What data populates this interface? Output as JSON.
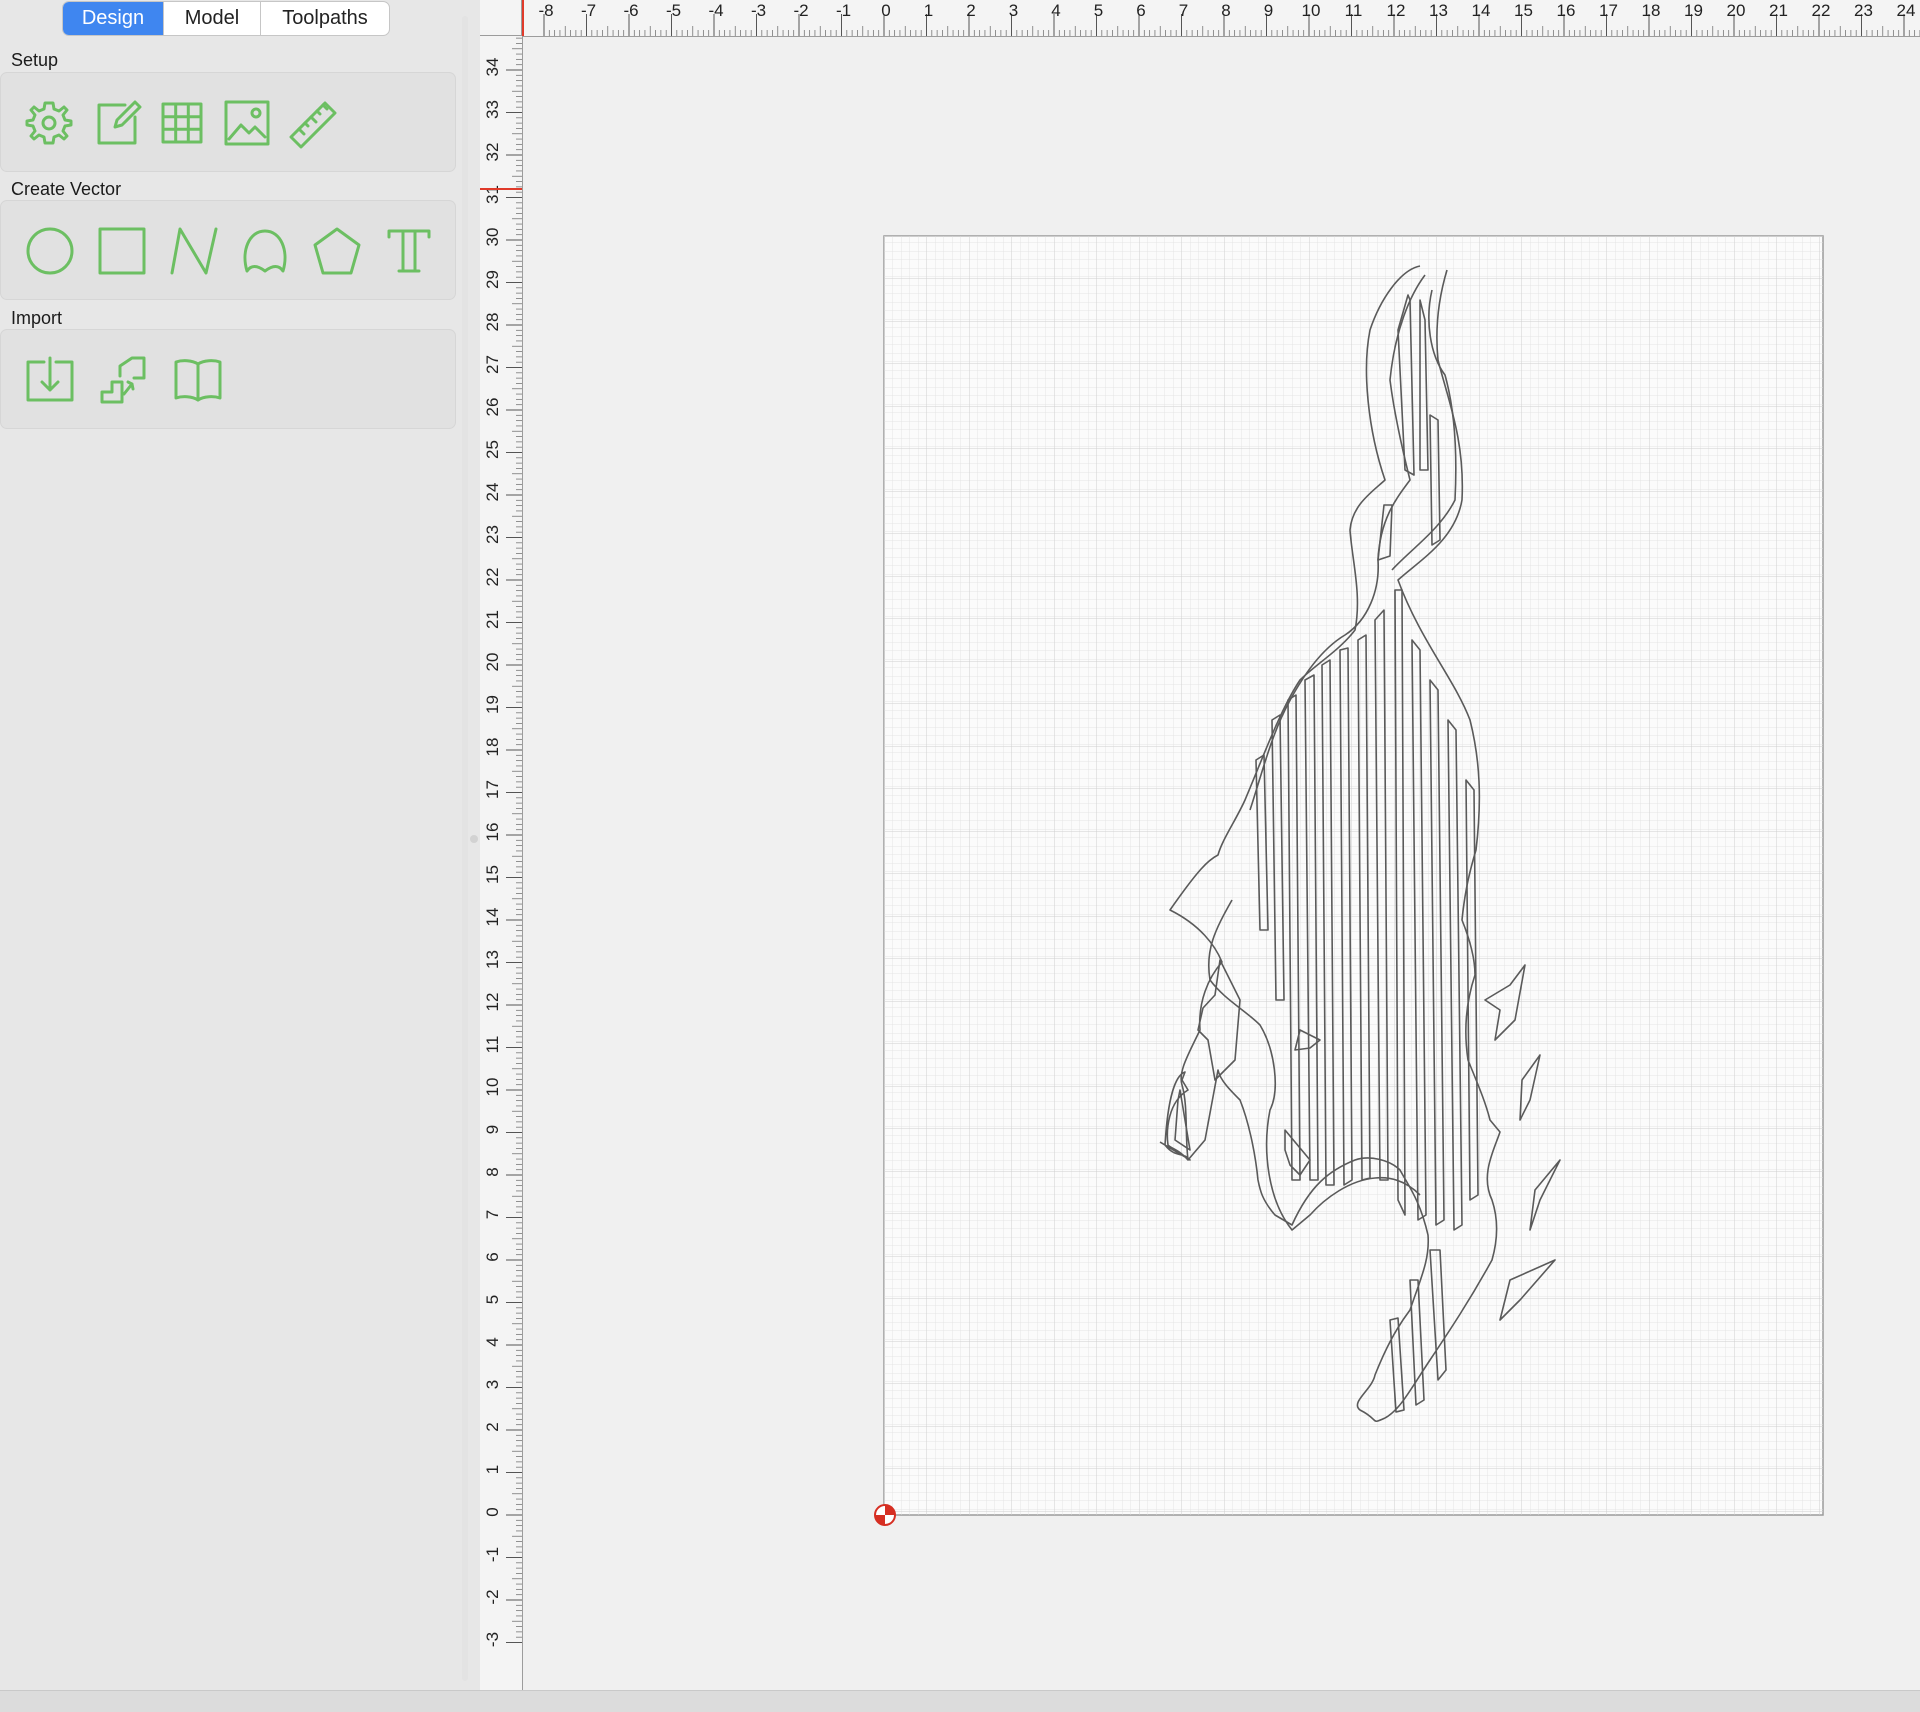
{
  "tabs": [
    {
      "label": "Design",
      "active": true
    },
    {
      "label": "Model",
      "active": false
    },
    {
      "label": "Toolpaths",
      "active": false
    }
  ],
  "sections": {
    "setup": {
      "label": "Setup",
      "icons": [
        "job-setup-gear-icon",
        "edit-job-icon",
        "grid-table-icon",
        "image-icon",
        "ruler-measure-icon"
      ]
    },
    "create_vector": {
      "label": "Create Vector",
      "icons": [
        "circle-icon",
        "rectangle-icon",
        "polyline-icon",
        "curve-shape-icon",
        "polygon-icon",
        "text-icon"
      ]
    },
    "import": {
      "label": "Import",
      "icons": [
        "import-file-icon",
        "import-3d-steps-icon",
        "clipart-book-icon"
      ]
    }
  },
  "rulers": {
    "horizontal": {
      "from": -8,
      "to": 24
    },
    "vertical": {
      "from": -3,
      "to": 34
    }
  },
  "material": {
    "width": 22,
    "height": 30
  },
  "colors": {
    "accent": "#3f86f0",
    "icon_green": "#6cbf62",
    "cursor_red": "#e03a2a",
    "grid_line": "#d9d9d9",
    "vector_line": "#555555"
  }
}
